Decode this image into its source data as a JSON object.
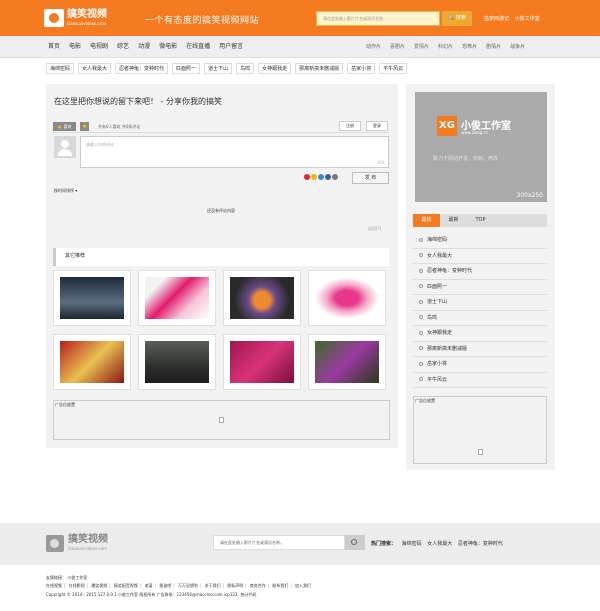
{
  "header": {
    "logo_title": "搞笑视频",
    "logo_sub": "Gaoxiaovideos.com",
    "slogan": "一个有态度的搞笑视频网站",
    "search_placeholder": "请在此处输入影片片名或演员名称。",
    "search_button": "搜索",
    "links": [
      "苗家西游记",
      "小俊工作室"
    ]
  },
  "nav": {
    "main": [
      "首页",
      "电影",
      "电视剧",
      "综艺",
      "动漫",
      "微电影",
      "在线直播",
      "用户留言"
    ],
    "sub": [
      "动作片",
      "喜剧片",
      "爱情片",
      "科幻片",
      "恐怖片",
      "剧情片",
      "战争片"
    ]
  },
  "tags": [
    "海绵密码",
    "女人我最大",
    "忍者神龟：变种时代",
    "匹面照一",
    "道士下山",
    "鸟鸣",
    "女神跟我走",
    "那离新搞未删减版",
    "岳家小将",
    "平牛风云"
  ],
  "main": {
    "title": "在这里把你想说的留下来吧！ - 分享你我的搞笑",
    "like_label": "喜欢",
    "comment_stats": "共有0人喜欢  共0条评论",
    "register": "注册",
    "login": "登录",
    "comment_placeholder": "请输入你的评论",
    "char_count": "300",
    "publish": "发 布",
    "sort_label": "按时间排序",
    "empty_text": "还没有评论内容",
    "report": "告页[?]",
    "recommend_title": "其它推荐",
    "ad_label": "广告位放置"
  },
  "side": {
    "ad_logo": "XG",
    "ad_title": "小俊工作室",
    "ad_url": "www.sloog.cc",
    "ad_slogan": "致力于网站开发，仿制，修改",
    "ad_dims": "300x250",
    "tabs": [
      "最热",
      "最新",
      "TOP"
    ],
    "list": [
      "海绵密码",
      "女人我最大",
      "忍者神龟：变种时代",
      "匹面照一",
      "道士下山",
      "鸟鸣",
      "女神跟我走",
      "那离新搞未删减版",
      "岳家小将",
      "平牛风云"
    ],
    "ad2_label": "广告位放置"
  },
  "footer": {
    "logo_title": "搞笑视频",
    "logo_sub": "Gaoxiaovideos.com",
    "search_placeholder": "请在此处输入影片片名或演员名称。",
    "hot_label": "热门搜索：",
    "hot": [
      "海绵密码",
      "女人我最大",
      "忍者神龟：变种时代"
    ],
    "links_line": "友情链接：  小俊工作室",
    "nav": [
      "在线视频",
      "在线影视",
      "爆笑视频",
      "搞笑配音视频",
      "老谋",
      "我谁吧",
      "万万没想到",
      "关于我们",
      "隐私声明",
      "商务合作",
      "联系我们",
      "加入我们"
    ],
    "copyright": "Copyright © 2014 - 2015 127.0.0.1 小俊工作室 版权所有 广告联系：123456@maccmo.com icp123",
    "stats": "统计代码"
  },
  "colors": {
    "brand": "#f47b20",
    "search_bg": "#fff3cc",
    "search_btn": "#f0a830"
  }
}
